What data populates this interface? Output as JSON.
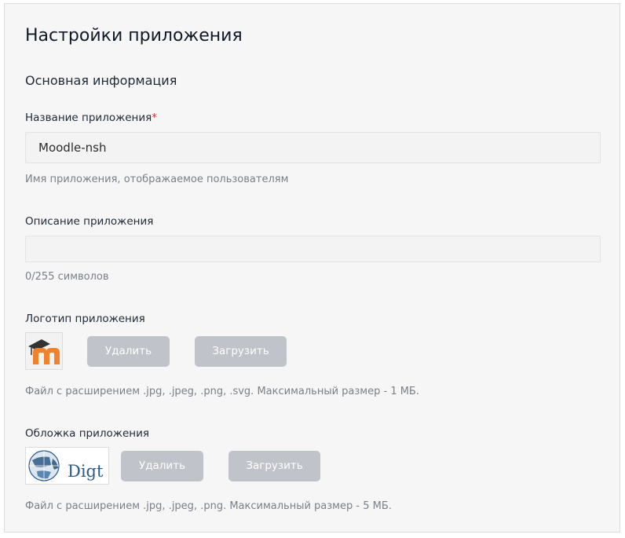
{
  "page": {
    "title": "Настройки приложения",
    "section_title": "Основная информация"
  },
  "name_field": {
    "label": "Название приложения",
    "required_mark": "*",
    "value": "Moodle-nsh",
    "hint": "Имя приложения, отображаемое пользователям"
  },
  "description_field": {
    "label": "Описание приложения",
    "value": "",
    "counter": "0/255 символов"
  },
  "logo": {
    "label": "Логотип приложения",
    "delete_label": "Удалить",
    "upload_label": "Загрузить",
    "hint": "Файл с расширением .jpg, .jpeg, .png, .svg. Максимальный размер - 1 МБ.",
    "image_text": "m"
  },
  "cover": {
    "label": "Обложка приложения",
    "delete_label": "Удалить",
    "upload_label": "Загрузить",
    "hint": "Файл с расширением .jpg, .jpeg, .png. Максимальный размер - 5 МБ.",
    "image_text": "Digt"
  },
  "colors": {
    "panel_bg": "#f6f6f6",
    "button_bg": "#c1c3ca",
    "required": "#e0303b",
    "moodle_orange": "#f0822c",
    "digt_blue": "#2e5a87"
  }
}
